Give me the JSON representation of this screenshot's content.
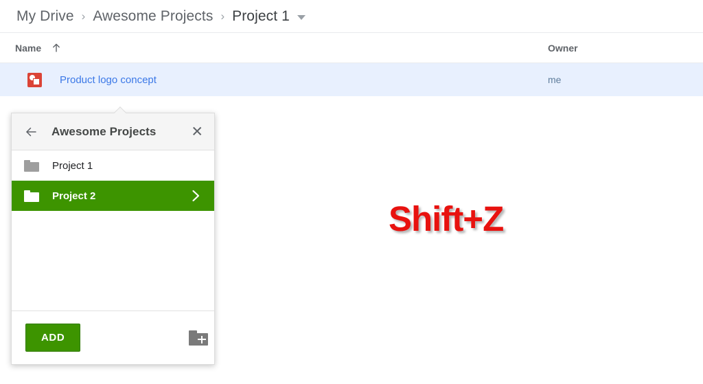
{
  "breadcrumb": {
    "items": [
      {
        "label": "My Drive"
      },
      {
        "label": "Awesome Projects"
      },
      {
        "label": "Project 1"
      }
    ],
    "separator": "›",
    "dropdown_icon": "caret-down-icon"
  },
  "table": {
    "columns": {
      "name": "Name",
      "owner": "Owner"
    },
    "sort_icon": "arrow-up-icon",
    "rows": [
      {
        "icon": "google-drawing-icon",
        "name": "Product logo concept",
        "owner": "me",
        "selected": true
      }
    ]
  },
  "overlay": {
    "shortcut_text": "Shift+Z",
    "color": "#e8120f"
  },
  "popup": {
    "back_icon": "arrow-left-icon",
    "title": "Awesome Projects",
    "close_icon": "close-icon",
    "items": [
      {
        "label": "Project 1",
        "icon": "folder-icon",
        "selected": false,
        "chevron": ""
      },
      {
        "label": "Project 2",
        "icon": "folder-icon",
        "selected": true,
        "chevron": "chevron-right-icon"
      }
    ],
    "footer": {
      "add_label": "ADD",
      "new_folder_icon": "new-folder-icon"
    },
    "accent_color": "#3d9400"
  }
}
